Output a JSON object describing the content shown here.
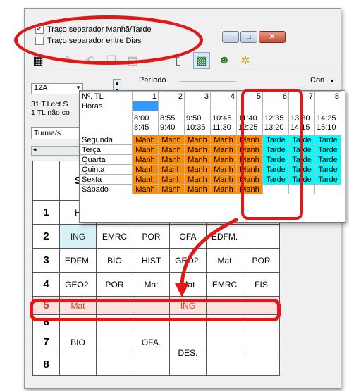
{
  "options": {
    "morning_afternoon": {
      "label": "Traço separador Manhã/Tarde",
      "checked": true
    },
    "between_days": {
      "label": "Traço separador entre Dias",
      "checked": false
    }
  },
  "window_buttons": {
    "minimize": "–",
    "maximize": "□",
    "close": "✕"
  },
  "toolbar_icons": [
    "grid-icon",
    "pencil-icon",
    "undo-icon",
    "copy-icon",
    "document-icon",
    "separator-icon",
    "timetable-icon",
    "people-icon",
    "gears-icon"
  ],
  "left_panel": {
    "class_select": "12A",
    "info_line1": "31  T.Lect.S",
    "info_line2": "1  TL não co",
    "turma_label": "Turma/s"
  },
  "periodo_label": "Período",
  "com_label": "Con",
  "popup": {
    "header_label": "Nº. TL",
    "horas_label": "Horas",
    "numbers": [
      "1",
      "2",
      "3",
      "4",
      "5",
      "6",
      "7",
      "8"
    ],
    "start_times": [
      "8:00",
      "8:55",
      "9:50",
      "10:45",
      "11:40",
      "12:35",
      "13:30",
      "14:25"
    ],
    "end_times": [
      "8:45",
      "9:40",
      "10:35",
      "11:30",
      "12:25",
      "13:20",
      "14:15",
      "15:10"
    ],
    "days": [
      {
        "name": "Segunda",
        "cells": [
          "Manh",
          "Manh",
          "Manh",
          "Manh",
          "Manh",
          "Tarde",
          "Tarde",
          "Tarde"
        ]
      },
      {
        "name": "Terça",
        "cells": [
          "Manh",
          "Manh",
          "Manh",
          "Manh",
          "Manh",
          "Tarde",
          "Tarde",
          "Tarde"
        ]
      },
      {
        "name": "Quarta",
        "cells": [
          "Manh",
          "Manh",
          "Manh",
          "Manh",
          "Manh",
          "Tarde",
          "Tarde",
          "Tarde"
        ]
      },
      {
        "name": "Quinta",
        "cells": [
          "Manh",
          "Manh",
          "Manh",
          "Manh",
          "Manh",
          "Tarde",
          "Tarde",
          "Tarde"
        ]
      },
      {
        "name": "Sexta",
        "cells": [
          "Manh",
          "Manh",
          "Manh",
          "Manh",
          "Manh",
          "Tarde",
          "Tarde",
          "Tarde"
        ]
      },
      {
        "name": "Sábado",
        "cells": [
          "Manh",
          "Manh",
          "Manh",
          "Manh",
          "Manh",
          "",
          "",
          ""
        ]
      }
    ]
  },
  "timetable": {
    "header_fragment": "S",
    "rows": [
      {
        "num": "1",
        "cells": [
          "H",
          "",
          "",
          "",
          "",
          ""
        ]
      },
      {
        "num": "2",
        "cells": [
          "ING",
          "EMRC",
          "POR",
          "OFA",
          "EDFM.",
          ""
        ]
      },
      {
        "num": "3",
        "cells": [
          "EDFM.",
          "BIO",
          "HIST",
          "GEO2.",
          "Mat",
          "POR"
        ]
      },
      {
        "num": "4",
        "cells": [
          "GEO2.",
          "POR",
          "Mat",
          "Mat",
          "EMRC",
          "FIS"
        ]
      },
      {
        "num": "5",
        "cells": [
          "Mat",
          "",
          "",
          "ING",
          "",
          ""
        ]
      },
      {
        "num": "6",
        "cells": [
          "",
          "",
          "",
          "",
          "",
          ""
        ]
      },
      {
        "num": "7",
        "cells": [
          "BIO",
          "",
          "OFA.",
          "DES.",
          "",
          ""
        ]
      },
      {
        "num": "8",
        "cells": [
          "",
          "",
          "",
          "",
          "",
          ""
        ]
      }
    ]
  },
  "colors": {
    "morning": "#ff8c00",
    "afternoon": "#00ffff",
    "annotation": "#e01818",
    "selected_cell": "#3399ff"
  }
}
